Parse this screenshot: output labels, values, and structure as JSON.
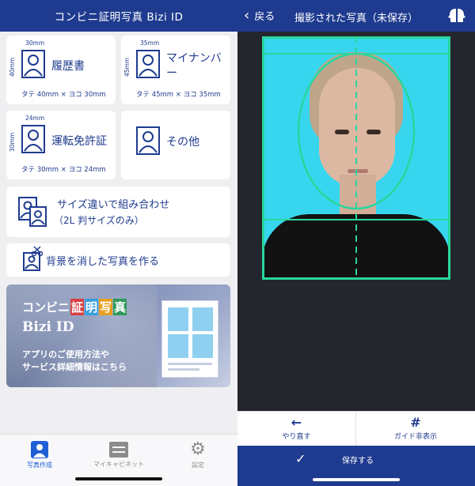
{
  "left": {
    "title": "コンビニ証明写真 Bizi ID",
    "cards": [
      {
        "label": "履歴書",
        "width_mm": "30mm",
        "height_mm": "40mm",
        "spec": "タテ 40mm × ヨコ 30mm"
      },
      {
        "label": "マイナンバー",
        "width_mm": "35mm",
        "height_mm": "45mm",
        "spec": "タテ 45mm × ヨコ 35mm"
      },
      {
        "label": "運転免許証",
        "width_mm": "24mm",
        "height_mm": "30mm",
        "spec": "タテ 30mm × ヨコ 24mm"
      },
      {
        "label": "その他"
      }
    ],
    "combo": {
      "line1": "サイズ違いで組み合わせ",
      "line2": "（2L 判サイズのみ）"
    },
    "bg_remove": {
      "label": "背景を消した写真を作る"
    },
    "banner": {
      "title_a": "コンビニ",
      "title_b": [
        "証",
        "明",
        "写",
        "真"
      ],
      "brand": "Bizi ID",
      "line1": "アプリのご使用方法や",
      "line2": "サービス詳細情報はこちら"
    },
    "tabs": [
      {
        "label": "写真作成",
        "icon": "person-icon",
        "active": true
      },
      {
        "label": "マイキャビネット",
        "icon": "cabinet-icon",
        "active": false
      },
      {
        "label": "設定",
        "icon": "gear-icon",
        "active": false
      }
    ]
  },
  "right": {
    "back_label": "戻る",
    "title": "撮影された写真（未保存）",
    "actions": [
      {
        "label": "やり直す",
        "icon": "arrow-left-icon"
      },
      {
        "label": "ガイド非表示",
        "icon": "hash-grid-icon"
      }
    ],
    "save_label": "保存する"
  },
  "colors": {
    "brand_blue": "#1f3b8f",
    "guide_green": "#29d69b",
    "photo_bg": "#38d6ee"
  }
}
